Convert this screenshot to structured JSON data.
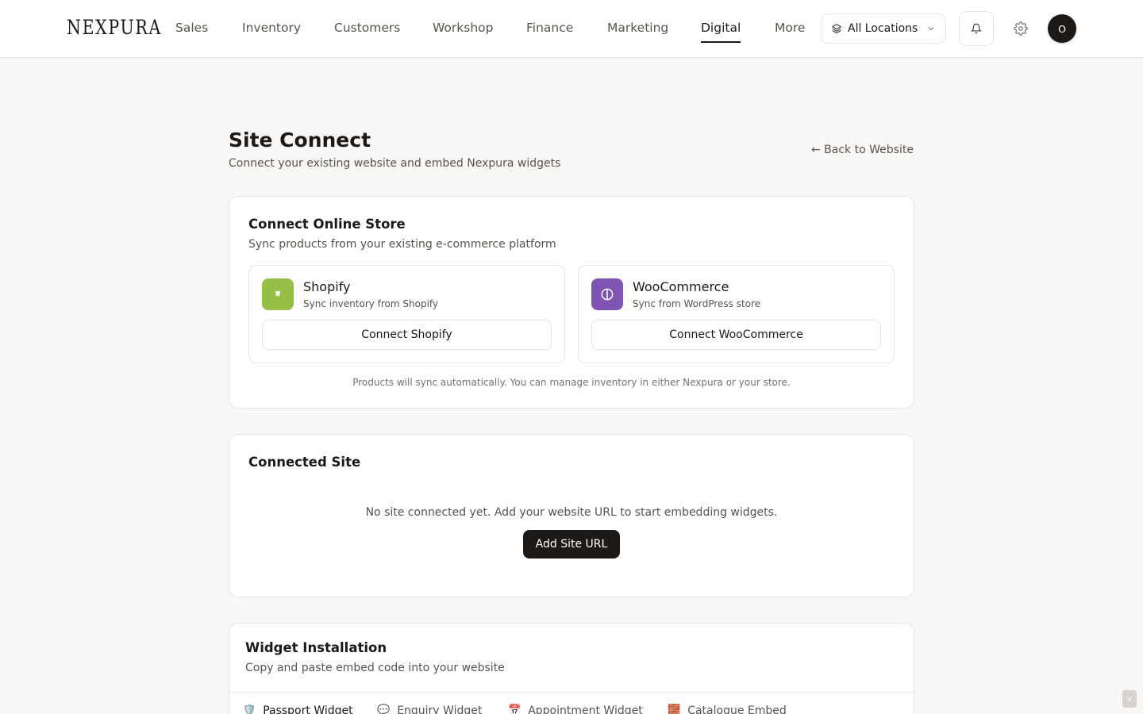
{
  "brand": {
    "logo": "NEXPURA"
  },
  "nav": {
    "items": [
      {
        "label": "Sales"
      },
      {
        "label": "Inventory"
      },
      {
        "label": "Customers"
      },
      {
        "label": "Workshop"
      },
      {
        "label": "Finance"
      },
      {
        "label": "Marketing"
      },
      {
        "label": "Digital",
        "active": true
      },
      {
        "label": "More"
      }
    ],
    "location": "All Locations",
    "avatar_initial": "O"
  },
  "header": {
    "title": "Site Connect",
    "subtitle": "Connect your existing website and embed Nexpura widgets",
    "back_link": "← Back to Website"
  },
  "online_store": {
    "title": "Connect Online Store",
    "subtitle": "Sync products from your existing e-commerce platform",
    "platforms": [
      {
        "name": "Shopify",
        "desc": "Sync inventory from Shopify",
        "button": "Connect Shopify",
        "color": "#95bf47"
      },
      {
        "name": "WooCommerce",
        "desc": "Sync from WordPress store",
        "button": "Connect WooCommerce",
        "color": "#7f54b3"
      }
    ],
    "note": "Products will sync automatically. You can manage inventory in either Nexpura or your store."
  },
  "connected_site": {
    "title": "Connected Site",
    "empty": "No site connected yet. Add your website URL to start embedding widgets.",
    "button": "Add Site URL"
  },
  "widgets": {
    "title": "Widget Installation",
    "subtitle": "Copy and paste embed code into your website",
    "tabs": [
      {
        "icon": "🛡️",
        "label": "Passport Widget",
        "active": true
      },
      {
        "icon": "💬",
        "label": "Enquiry Widget"
      },
      {
        "icon": "📅",
        "label": "Appointment Widget"
      },
      {
        "icon": "🧱",
        "label": "Catalogue Embed"
      }
    ]
  },
  "scroll_label": "v"
}
